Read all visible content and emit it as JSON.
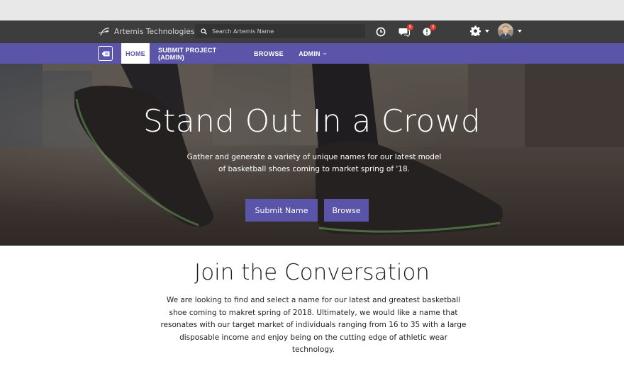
{
  "header": {
    "brand_name": "Artemis Technologies",
    "search_placeholder": "Search Artemis Name",
    "icons": [
      "history-icon",
      "chat-icon",
      "notifications-icon",
      "gear-icon"
    ],
    "chat_badge": "5",
    "notification_badge": "3"
  },
  "nav": {
    "items": [
      {
        "label": "HOME",
        "active": true
      },
      {
        "label": "SUBMIT PROJECT (ADMIN)",
        "active": false
      },
      {
        "label": "BROWSE",
        "active": false
      },
      {
        "label": "ADMIN",
        "active": false
      }
    ]
  },
  "hero": {
    "title": "Stand Out In a Crowd",
    "subtitle_line1": "Gather and generate a variety of unique names for our latest model",
    "subtitle_line2": "of basketball shoes coming to market spring of '18.",
    "primary_button": "Submit Name",
    "secondary_button": "Browse"
  },
  "conversation": {
    "title": "Join the Conversation",
    "body_line1": "We are looking to find and select a name for our latest and greatest basketball",
    "body_line2": "shoe coming to makret spring of 2018. Ultimately, we would like a name that",
    "body_line3": "resonates with our target market of individuals ranging from 16 to 35 with a large",
    "body_line4": "disposable income and enjoy being on the cutting edge of athletic wear technology."
  },
  "colors": {
    "brand_purple": "#5b55a9",
    "topbar": "#3d3d3d",
    "badge_red": "#e03b2c"
  }
}
